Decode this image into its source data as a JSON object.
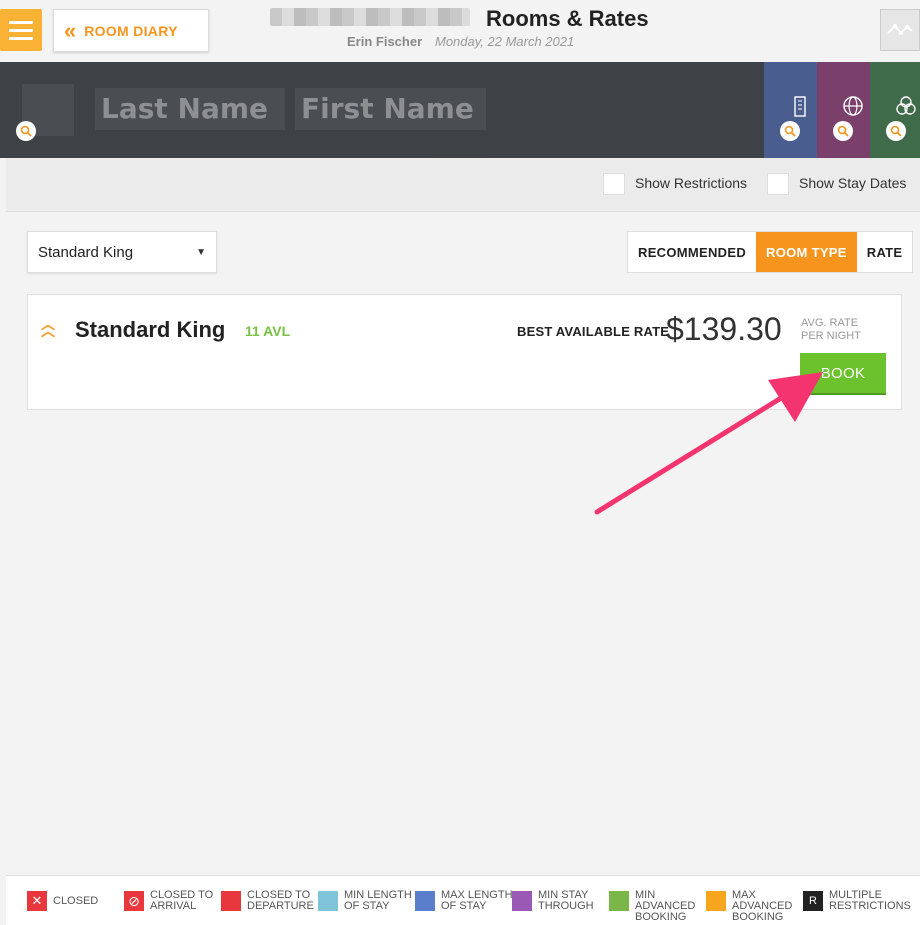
{
  "header": {
    "room_diary_label": "ROOM DIARY",
    "page_title": "Rooms & Rates",
    "user_name": "Erin Fischer",
    "date": "Monday, 22 March 2021"
  },
  "search": {
    "last_name_placeholder": "Last Name",
    "first_name_placeholder": "First Name"
  },
  "filters": {
    "show_restrictions": "Show Restrictions",
    "show_stay_dates": "Show Stay Dates"
  },
  "controls": {
    "room_select_value": "Standard King",
    "tabs": [
      {
        "label": "RECOMMENDED",
        "active": false
      },
      {
        "label": "ROOM TYPE",
        "active": true
      },
      {
        "label": "RATE",
        "active": false
      }
    ]
  },
  "room_card": {
    "name": "Standard King",
    "availability": "11 AVL",
    "rate_label": "BEST AVAILABLE RATE",
    "price": "$139.30",
    "avg_line1": "AVG. RATE",
    "avg_line2": "PER NIGHT",
    "book_label": "BOOK"
  },
  "legend": [
    {
      "line1": "CLOSED",
      "line2": "",
      "line3": "",
      "color": "#e8383d",
      "symbol": "✕"
    },
    {
      "line1": "CLOSED TO",
      "line2": "ARRIVAL",
      "line3": "",
      "color": "#e8383d",
      "symbol": "⊘"
    },
    {
      "line1": "CLOSED TO",
      "line2": "DEPARTURE",
      "line3": "",
      "color": "#e8383d",
      "symbol": ""
    },
    {
      "line1": "MIN LENGTH",
      "line2": "OF STAY",
      "line3": "",
      "color": "#7fc4d9",
      "symbol": ""
    },
    {
      "line1": "MAX LENGTH",
      "line2": "OF STAY",
      "line3": "",
      "color": "#5a7ecb",
      "symbol": ""
    },
    {
      "line1": "MIN STAY",
      "line2": "THROUGH",
      "line3": "",
      "color": "#9b59b6",
      "symbol": ""
    },
    {
      "line1": "MIN",
      "line2": "ADVANCED",
      "line3": "BOOKING",
      "color": "#7ab648",
      "symbol": ""
    },
    {
      "line1": "MAX",
      "line2": "ADVANCED",
      "line3": "BOOKING",
      "color": "#f7a51c",
      "symbol": ""
    },
    {
      "line1": "MULTIPLE",
      "line2": "RESTRICTIONS",
      "line3": "",
      "color": "#222222",
      "symbol": "R"
    }
  ],
  "colors": {
    "accent_orange": "#f7941d",
    "menu_yellow": "#f9b233",
    "book_green": "#6bc22c",
    "avl_green": "#7ac143",
    "annotation_pink": "#f4346e"
  },
  "panels": [
    {
      "icon": "building-icon",
      "color": "#4a5d8f"
    },
    {
      "icon": "globe-icon",
      "color": "#7a3f6a"
    },
    {
      "icon": "group-icon",
      "color": "#3f6b4a"
    }
  ]
}
